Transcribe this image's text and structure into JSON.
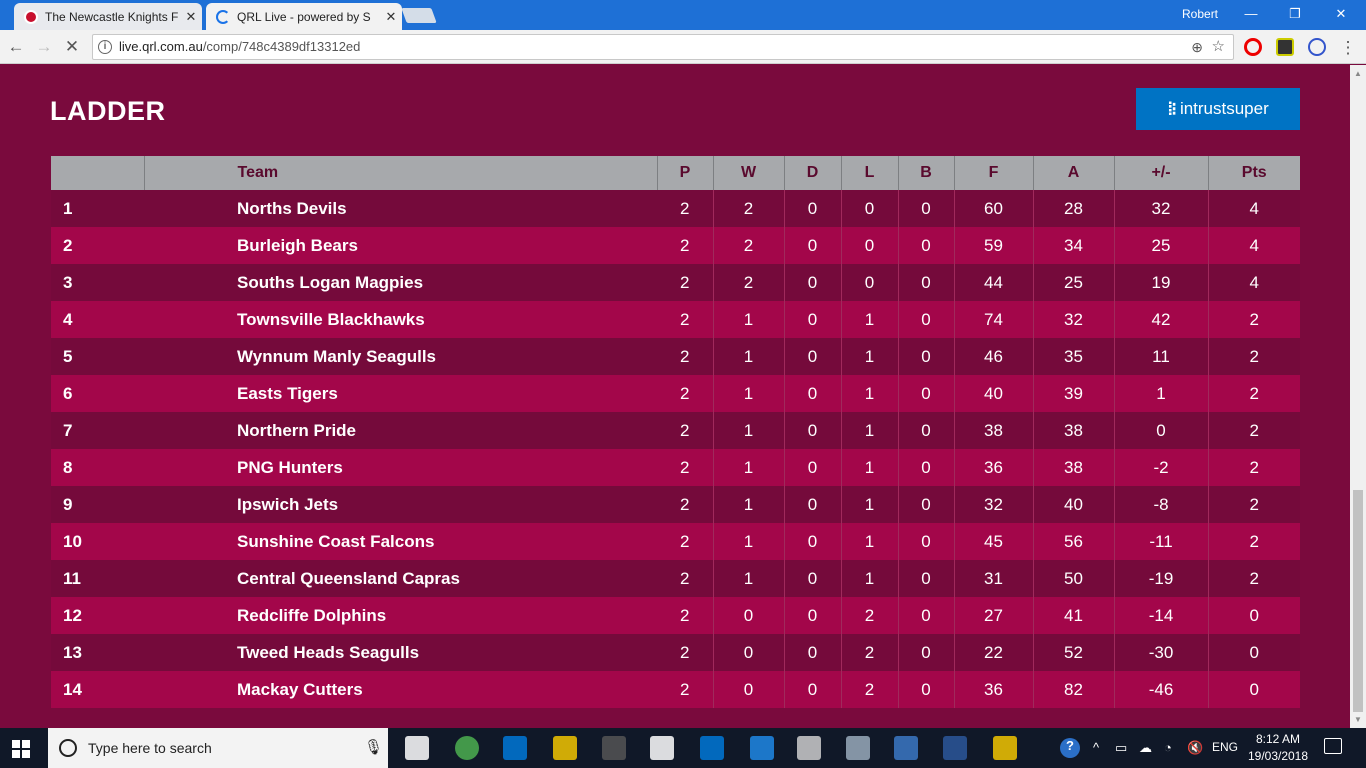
{
  "browser": {
    "tabs": [
      {
        "title": "The Newcastle Knights F",
        "favicon": "knights-favicon",
        "active": false
      },
      {
        "title": "QRL Live - powered by S",
        "favicon": "loading-spinner",
        "active": true
      }
    ],
    "user": "Robert",
    "window_controls": [
      "—",
      "❐",
      "✕"
    ],
    "url_domain": "live.qrl.com.au",
    "url_path": "/comp/748c4389df13312ed"
  },
  "page": {
    "title": "LADDER",
    "sponsor": "intrustsuper",
    "colors": {
      "background": "#7a0a3d",
      "row_odd": "#750a3b",
      "row_even": "#a3064a",
      "header": "#a7a9ac",
      "sponsor": "#0073c4"
    }
  },
  "ladder": {
    "columns": [
      "",
      "Team",
      "P",
      "W",
      "D",
      "L",
      "B",
      "F",
      "A",
      "+/-",
      "Pts"
    ],
    "rows": [
      [
        "1",
        "Norths Devils",
        "2",
        "2",
        "0",
        "0",
        "0",
        "60",
        "28",
        "32",
        "4"
      ],
      [
        "2",
        "Burleigh Bears",
        "2",
        "2",
        "0",
        "0",
        "0",
        "59",
        "34",
        "25",
        "4"
      ],
      [
        "3",
        "Souths Logan Magpies",
        "2",
        "2",
        "0",
        "0",
        "0",
        "44",
        "25",
        "19",
        "4"
      ],
      [
        "4",
        "Townsville Blackhawks",
        "2",
        "1",
        "0",
        "1",
        "0",
        "74",
        "32",
        "42",
        "2"
      ],
      [
        "5",
        "Wynnum Manly Seagulls",
        "2",
        "1",
        "0",
        "1",
        "0",
        "46",
        "35",
        "11",
        "2"
      ],
      [
        "6",
        "Easts Tigers",
        "2",
        "1",
        "0",
        "1",
        "0",
        "40",
        "39",
        "1",
        "2"
      ],
      [
        "7",
        "Northern Pride",
        "2",
        "1",
        "0",
        "1",
        "0",
        "38",
        "38",
        "0",
        "2"
      ],
      [
        "8",
        "PNG Hunters",
        "2",
        "1",
        "0",
        "1",
        "0",
        "36",
        "38",
        "-2",
        "2"
      ],
      [
        "9",
        "Ipswich Jets",
        "2",
        "1",
        "0",
        "1",
        "0",
        "32",
        "40",
        "-8",
        "2"
      ],
      [
        "10",
        "Sunshine Coast Falcons",
        "2",
        "1",
        "0",
        "1",
        "0",
        "45",
        "56",
        "-11",
        "2"
      ],
      [
        "11",
        "Central Queensland Capras",
        "2",
        "1",
        "0",
        "1",
        "0",
        "31",
        "50",
        "-19",
        "2"
      ],
      [
        "12",
        "Redcliffe Dolphins",
        "2",
        "0",
        "0",
        "2",
        "0",
        "27",
        "41",
        "-14",
        "0"
      ],
      [
        "13",
        "Tweed Heads Seagulls",
        "2",
        "0",
        "0",
        "2",
        "0",
        "22",
        "52",
        "-30",
        "0"
      ],
      [
        "14",
        "Mackay Cutters",
        "2",
        "0",
        "0",
        "2",
        "0",
        "36",
        "82",
        "-46",
        "0"
      ]
    ]
  },
  "taskbar": {
    "search_placeholder": "Type here to search",
    "language": "ENG",
    "time": "8:12 AM",
    "date": "19/03/2018",
    "pinned_icons": [
      "task-view-icon",
      "chrome-icon",
      "store-icon",
      "file-explorer-icon",
      "calculator-icon",
      "settings-icon",
      "outlook-icon",
      "edge-icon",
      "paint-icon",
      "photos-icon",
      "remote-desktop-icon",
      "word-icon",
      "norton-icon"
    ]
  }
}
